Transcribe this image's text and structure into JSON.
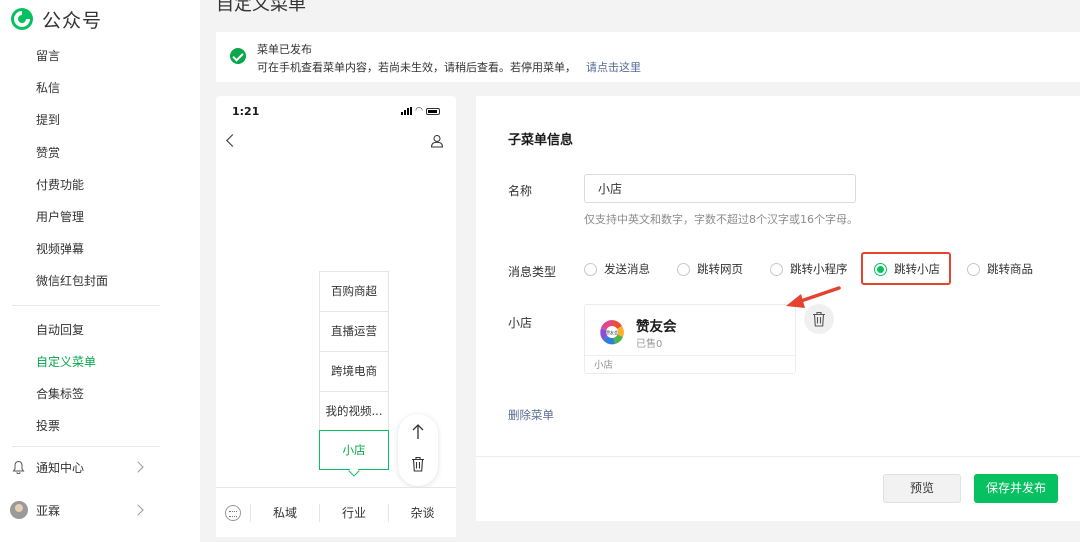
{
  "brand": {
    "name": "公众号",
    "accent": "#07c160"
  },
  "page": {
    "title": "自定义菜单"
  },
  "sidebar": {
    "items": [
      {
        "label": "留言"
      },
      {
        "label": "私信"
      },
      {
        "label": "提到"
      },
      {
        "label": "赞赏"
      },
      {
        "label": "付费功能"
      },
      {
        "label": "用户管理"
      },
      {
        "label": "视频弹幕"
      },
      {
        "label": "微信红包封面"
      }
    ],
    "items2": [
      {
        "label": "自动回复"
      },
      {
        "label": "自定义菜单",
        "active": true
      },
      {
        "label": "合集标签"
      },
      {
        "label": "投票"
      }
    ],
    "notification_label": "通知中心",
    "user_name": "亚霖"
  },
  "notice": {
    "title": "菜单已发布",
    "body": "可在手机查看菜单内容，若尚未生效，请稍后查看。若停用菜单，",
    "link": "请点击这里"
  },
  "phone": {
    "time": "1:21",
    "submenu": [
      "百购商超",
      "直播运营",
      "跨境电商",
      "我的视频..."
    ],
    "active_submenu": "小店",
    "tabs": [
      "私域",
      "行业",
      "杂谈"
    ]
  },
  "editor": {
    "section_title": "子菜单信息",
    "name_label": "名称",
    "name_value": "小店",
    "name_hint": "仅支持中英文和数字，字数不超过8个汉字或16个字母。",
    "type_label": "消息类型",
    "types": [
      {
        "label": "发送消息",
        "checked": false
      },
      {
        "label": "跳转网页",
        "checked": false
      },
      {
        "label": "跳转小程序",
        "checked": false
      },
      {
        "label": "跳转小店",
        "checked": true
      },
      {
        "label": "跳转商品",
        "checked": false
      }
    ],
    "shop_label": "小店",
    "shop": {
      "name": "赞友会",
      "logo_text": "赞友会",
      "sold": "已售0",
      "footer": "小店"
    },
    "delete_menu": "删除菜单",
    "preview_button": "预览",
    "publish_button": "保存并发布"
  }
}
